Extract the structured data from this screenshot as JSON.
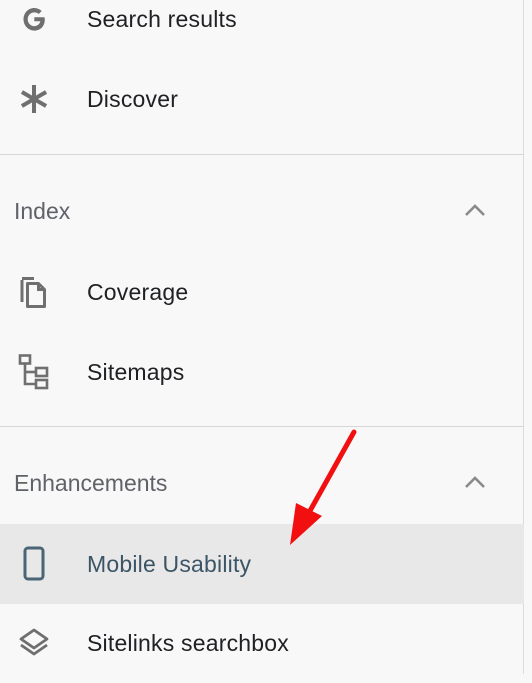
{
  "nav": {
    "top_items": [
      {
        "label": "Search results",
        "icon": "google-g-icon"
      },
      {
        "label": "Discover",
        "icon": "asterisk-icon"
      }
    ],
    "index_section": {
      "title": "Index",
      "items": [
        {
          "label": "Coverage",
          "icon": "copy-pages-icon"
        },
        {
          "label": "Sitemaps",
          "icon": "sitemap-tree-icon"
        }
      ]
    },
    "enhancements_section": {
      "title": "Enhancements",
      "items": [
        {
          "label": "Mobile Usability",
          "icon": "smartphone-icon",
          "selected": true
        },
        {
          "label": "Sitelinks searchbox",
          "icon": "layers-icon"
        }
      ]
    }
  },
  "colors": {
    "panel_background": "#f8f8f8",
    "selected_background": "#e8e8e8",
    "icon_gray": "#6f6f6f",
    "annotation_arrow": "#f20f0f"
  }
}
